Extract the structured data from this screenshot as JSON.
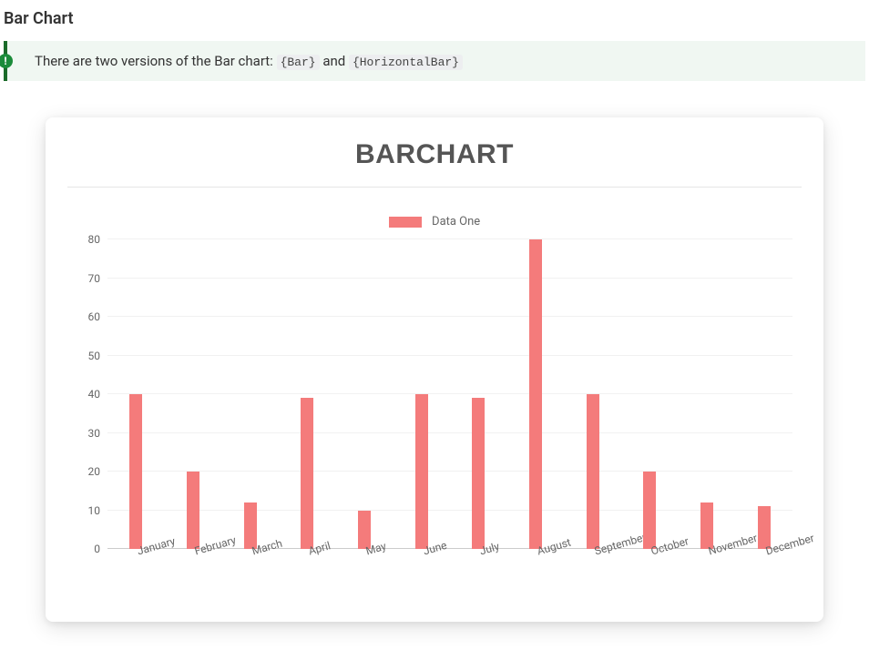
{
  "page": {
    "heading": "Bar Chart"
  },
  "tip": {
    "icon_label": "!",
    "text_prefix": "There are two versions of the Bar chart:",
    "code1": "{Bar}",
    "joiner": "and",
    "code2": "{HorizontalBar}"
  },
  "chart": {
    "title": "BARCHART",
    "legend_label": "Data One",
    "bar_color": "#f47b7b"
  },
  "chart_data": {
    "type": "bar",
    "title": "BARCHART",
    "categories": [
      "January",
      "February",
      "March",
      "April",
      "May",
      "June",
      "July",
      "August",
      "September",
      "October",
      "November",
      "December"
    ],
    "series": [
      {
        "name": "Data One",
        "values": [
          40,
          20,
          12,
          39,
          10,
          40,
          39,
          80,
          40,
          20,
          12,
          11
        ]
      }
    ],
    "xlabel": "",
    "ylabel": "",
    "y_ticks": [
      0,
      10,
      20,
      30,
      40,
      50,
      60,
      70,
      80
    ],
    "ylim": [
      0,
      80
    ]
  }
}
